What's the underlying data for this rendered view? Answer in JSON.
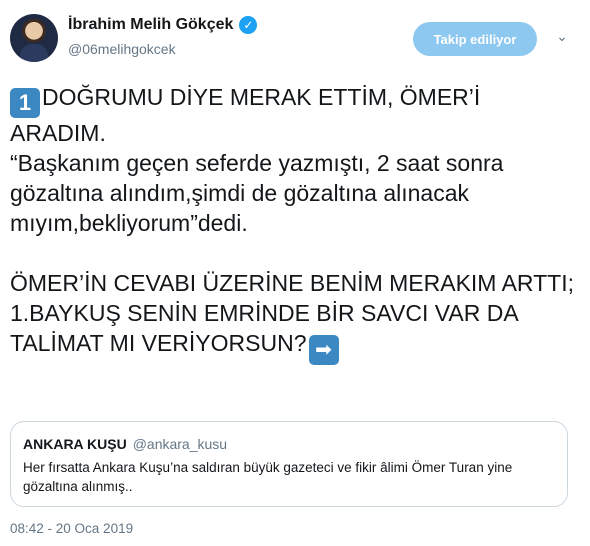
{
  "author": {
    "display_name": "İbrahim Melih Gökçek",
    "handle": "@06melihgokcek",
    "verified_icon": "verified-badge-icon"
  },
  "follow_button": {
    "label": "Takip ediliyor"
  },
  "menu": {
    "icon": "chevron-down-icon",
    "glyph": "⌄"
  },
  "tweet": {
    "keycap": "1",
    "line1": "DOĞRUMU DİYE MERAK ETTİM, ÖMER’İ ARADIM.",
    "quote_line": "“Başkanım geçen seferde yazmıştı, 2 saat sonra gözaltına alındım,şimdi de gözaltına alınacak mıyım,bekliyorum”dedi.",
    "para2": "ÖMER’İN CEVABI ÜZERİNE BENİM MERAKIM ARTTI;",
    "para3": "1.BAYKUŞ SENİN EMRİNDE BİR SAVCI VAR DA TALİMAT MI VERİYORSUN?",
    "arrow": "➡"
  },
  "quoted_tweet": {
    "name": "ANKARA KUŞU",
    "handle": "@ankara_kusu",
    "text": "Her fırsatta Ankara Kuşu’na saldıran büyük gazeteci ve fikir âlimi Ömer Turan yine gözaltına alınmış.."
  },
  "timestamp": "08:42 - 20 Oca 2019",
  "colors": {
    "accent": "#1da1f2",
    "follow_bg": "#8dc8f0",
    "secondary_text": "#657786",
    "keycap": "#3b88c3"
  }
}
